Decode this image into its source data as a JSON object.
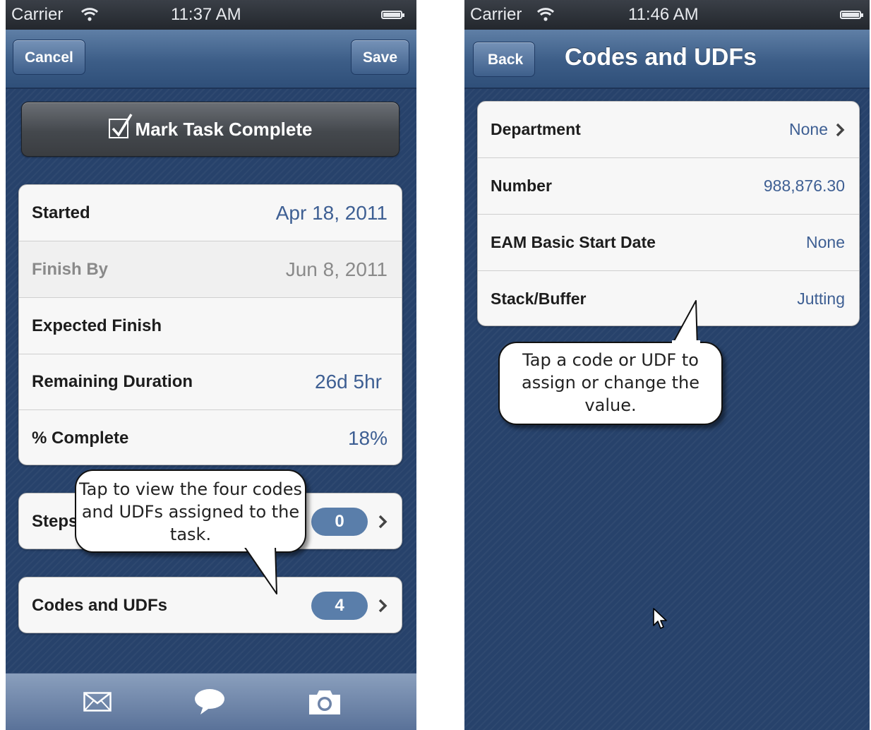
{
  "left_screen": {
    "status": {
      "carrier": "Carrier",
      "time": "11:37 AM"
    },
    "nav": {
      "cancel_label": "Cancel",
      "save_label": "Save"
    },
    "mark_complete_label": "Mark Task Complete",
    "details": [
      {
        "label": "Started",
        "value": "Apr 18, 2011"
      },
      {
        "label": "Finish By",
        "value": "Jun 8, 2011"
      },
      {
        "label": "Expected Finish",
        "value": ""
      },
      {
        "label": "Remaining Duration",
        "value": "26d 5hr"
      },
      {
        "label": "% Complete",
        "value": "18%"
      }
    ],
    "steps": {
      "label": "Steps",
      "count": "0"
    },
    "codes": {
      "label": "Codes and UDFs",
      "count": "4"
    },
    "callout": "Tap to view the four codes and UDFs assigned to the task.",
    "tabbar": {
      "icons": [
        "mail-icon",
        "comment-icon",
        "camera-icon"
      ]
    }
  },
  "right_screen": {
    "status": {
      "carrier": "Carrier",
      "time": "11:46 AM"
    },
    "nav": {
      "back_label": "Back",
      "title": "Codes and UDFs"
    },
    "codes": [
      {
        "label": "Department",
        "value": "None"
      },
      {
        "label": "Number",
        "value": "988,876.30"
      },
      {
        "label": "EAM Basic Start Date",
        "value": "None"
      },
      {
        "label": "Stack/Buffer",
        "value": "Jutting"
      }
    ],
    "callout": "Tap a code or UDF to assign or change the value."
  },
  "colors": {
    "background": "#27426b",
    "accent_value": "#3e5f93",
    "badge": "#5a7eaa"
  }
}
